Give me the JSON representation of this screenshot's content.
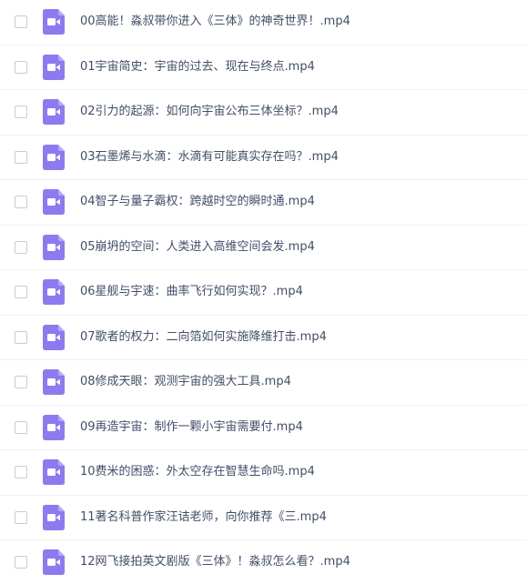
{
  "icon_color": "#8c7bef",
  "icon_symbol_color": "#ffffff",
  "files": [
    {
      "name": "00高能！淼叔带你进入《三体》的神奇世界！.mp4",
      "icon": "video-file-icon",
      "checked": false
    },
    {
      "name": "01宇宙简史：宇宙的过去、现在与终点.mp4",
      "icon": "video-file-icon",
      "checked": false
    },
    {
      "name": "02引力的起源：如何向宇宙公布三体坐标？.mp4",
      "icon": "video-file-icon",
      "checked": false
    },
    {
      "name": "03石墨烯与水滴：水滴有可能真实存在吗？.mp4",
      "icon": "video-file-icon",
      "checked": false
    },
    {
      "name": "04智子与量子霸权：跨越时空的瞬时通.mp4",
      "icon": "video-file-icon",
      "checked": false
    },
    {
      "name": "05崩坍的空间：人类进入高维空间会发.mp4",
      "icon": "video-file-icon",
      "checked": false
    },
    {
      "name": "06星舰与宇速：曲率飞行如何实现？.mp4",
      "icon": "video-file-icon",
      "checked": false
    },
    {
      "name": "07歌者的权力：二向箔如何实施降维打击.mp4",
      "icon": "video-file-icon",
      "checked": false
    },
    {
      "name": "08修成天眼：观测宇宙的强大工具.mp4",
      "icon": "video-file-icon",
      "checked": false
    },
    {
      "name": "09再造宇宙：制作一颗小宇宙需要付.mp4",
      "icon": "video-file-icon",
      "checked": false
    },
    {
      "name": "10费米的困惑：外太空存在智慧生命吗.mp4",
      "icon": "video-file-icon",
      "checked": false
    },
    {
      "name": "11著名科普作家汪诘老师，向你推荐《三.mp4",
      "icon": "video-file-icon",
      "checked": false
    },
    {
      "name": "12网飞接拍英文剧版《三体》！淼叔怎么看？.mp4",
      "icon": "video-file-icon",
      "checked": false
    }
  ]
}
